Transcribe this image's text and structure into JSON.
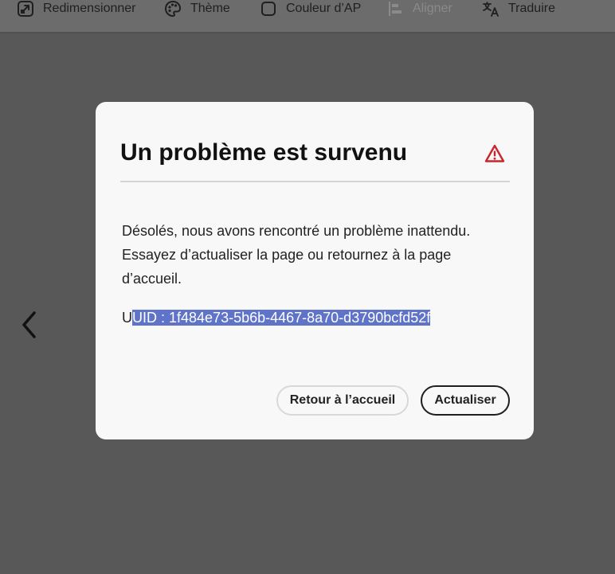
{
  "toolbar": {
    "items": [
      {
        "label": "Redimensionner",
        "icon": "resize-icon",
        "enabled": true
      },
      {
        "label": "Thème",
        "icon": "palette-icon",
        "enabled": true
      },
      {
        "label": "Couleur d’AP",
        "icon": "square-icon",
        "enabled": true
      },
      {
        "label": "Aligner",
        "icon": "align-icon",
        "enabled": false
      },
      {
        "label": "Traduire",
        "icon": "translate-icon",
        "enabled": true
      }
    ]
  },
  "navigation": {
    "prev_icon": "chevron-left-icon"
  },
  "dialog": {
    "title": "Un problème est survenu",
    "alert_icon": "alert-triangle-icon",
    "alert_color": "#c9252c",
    "message": "Désolés, nous avons rencontré un problème inattendu. Essayez d’actualiser la page ou retournez à la page d’accueil.",
    "uuid_prefix": "U",
    "uuid_selected": "UID : 1f484e73-5b6b-4467-8a70-d3790bcfd52f",
    "selection_color": "#5f73c9",
    "buttons": {
      "home": "Retour à l’accueil",
      "refresh": "Actualiser"
    }
  }
}
